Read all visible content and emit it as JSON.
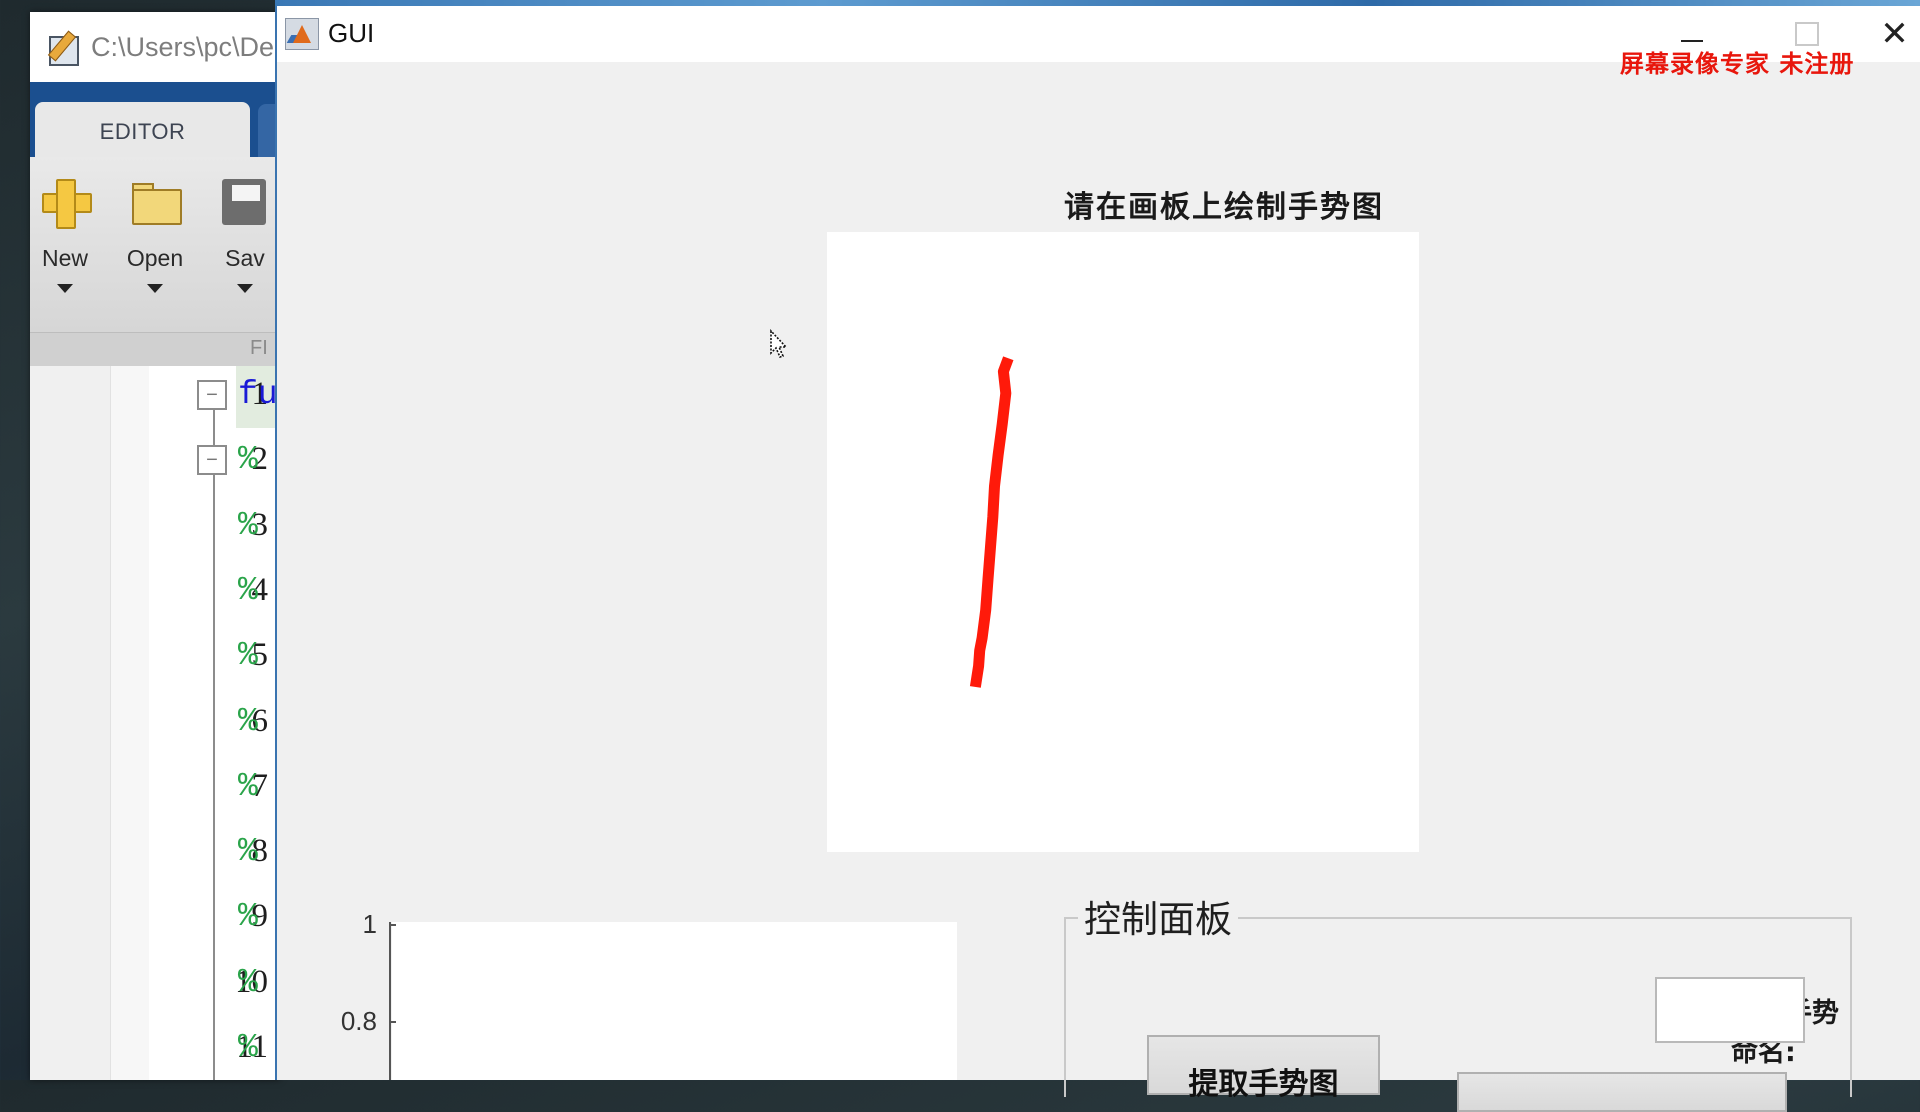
{
  "editor": {
    "title_path": "C:\\Users\\pc\\De",
    "tab_label": "EDITOR",
    "tools": [
      {
        "label": "New",
        "icon": "new-file-icon"
      },
      {
        "label": "Open",
        "icon": "open-folder-icon"
      },
      {
        "label": "Sav",
        "icon": "save-disk-icon"
      }
    ],
    "section_label": "FI",
    "code_lines": [
      {
        "num": "1",
        "text": "fu",
        "kind": "keyword",
        "fold": true
      },
      {
        "num": "2",
        "text": "%",
        "kind": "comment",
        "fold": true
      },
      {
        "num": "3",
        "text": "%",
        "kind": "comment",
        "fold": false
      },
      {
        "num": "4",
        "text": "%",
        "kind": "comment",
        "fold": false
      },
      {
        "num": "5",
        "text": "%",
        "kind": "comment",
        "fold": false
      },
      {
        "num": "6",
        "text": "%",
        "kind": "comment",
        "fold": false
      },
      {
        "num": "7",
        "text": "%",
        "kind": "comment",
        "fold": false
      },
      {
        "num": "8",
        "text": "%",
        "kind": "comment",
        "fold": false
      },
      {
        "num": "9",
        "text": "%",
        "kind": "comment",
        "fold": false
      },
      {
        "num": "10",
        "text": "%",
        "kind": "comment",
        "fold": false
      },
      {
        "num": "11",
        "text": "%",
        "kind": "comment",
        "fold": false
      }
    ]
  },
  "gui": {
    "window_title": "GUI",
    "watermark": "屏幕录像专家 未注册",
    "close_glyph": "✕",
    "drawing": {
      "title": "请在画板上绘制手势图",
      "stroke_color": "#ff1a0a",
      "stroke_points_normalized": [
        [
          0.303,
          0.212
        ],
        [
          0.298,
          0.225
        ],
        [
          0.302,
          0.26
        ],
        [
          0.296,
          0.31
        ],
        [
          0.289,
          0.36
        ],
        [
          0.283,
          0.41
        ],
        [
          0.28,
          0.46
        ],
        [
          0.276,
          0.51
        ],
        [
          0.272,
          0.56
        ],
        [
          0.268,
          0.61
        ],
        [
          0.262,
          0.655
        ],
        [
          0.258,
          0.675
        ],
        [
          0.256,
          0.7
        ],
        [
          0.252,
          0.725
        ]
      ]
    },
    "axes": {
      "y_ticks": [
        "1",
        "0.8"
      ]
    },
    "control_panel": {
      "title": "控制面板",
      "name_label": "输入手势命名:",
      "name_value": "",
      "extract_button": "提取手势图"
    }
  },
  "colors": {
    "watermark": "#e8160c",
    "editor_tab_bar": "#1b4f8f",
    "code_keyword": "#1a1ad6",
    "code_comment": "#2aa44a"
  }
}
